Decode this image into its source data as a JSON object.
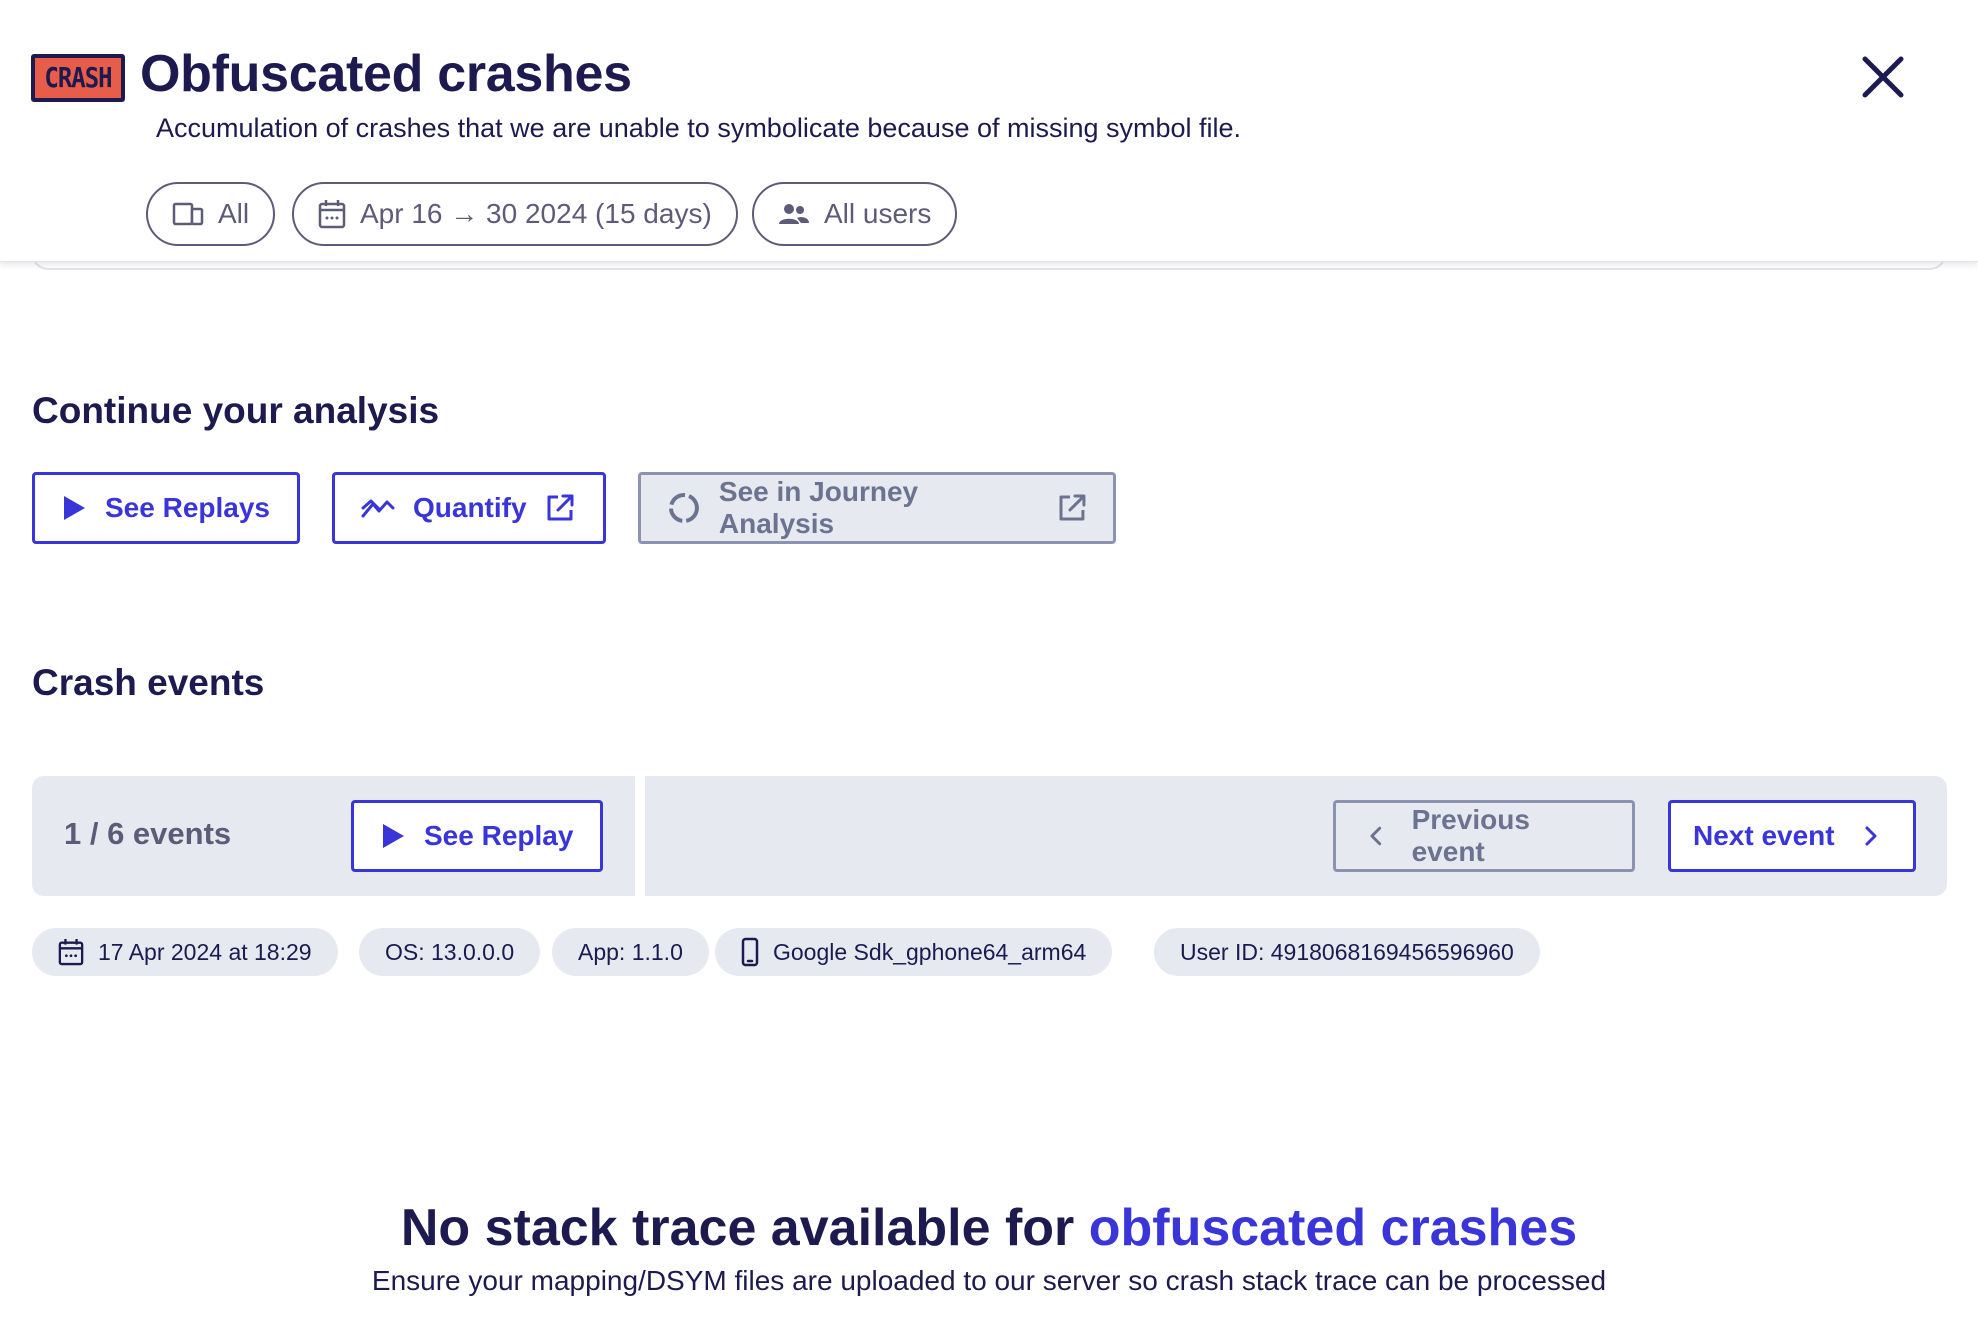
{
  "header": {
    "badge": "CRASH",
    "title": "Obfuscated crashes",
    "subtitle": "Accumulation of crashes that we are unable to symbolicate because of missing symbol file.",
    "filters": {
      "device": "All",
      "date_range": "Apr 16 → 30 2024 (15 days)",
      "users": "All users"
    }
  },
  "analysis": {
    "title": "Continue your analysis",
    "see_replays": "See Replays",
    "quantify": "Quantify",
    "journey": "See in Journey Analysis"
  },
  "crash_events": {
    "title": "Crash events",
    "count": "1 / 6 events",
    "see_replay": "See Replay",
    "previous": "Previous event",
    "next": "Next event",
    "tags": {
      "date": "17 Apr 2024 at 18:29",
      "os": "OS: 13.0.0.0",
      "app": "App: 1.1.0",
      "device": "Google Sdk_gphone64_arm64",
      "user_id": "User ID: 4918068169456596960"
    }
  },
  "empty_state": {
    "title_prefix": "No stack trace available for ",
    "title_accent": "obfuscated crashes",
    "subtitle": "Ensure your mapping/DSYM files are uploaded to our server so crash stack trace can be processed"
  },
  "colors": {
    "primary": "#3a35d8",
    "navy": "#1c1a4f",
    "badge": "#e85c4a",
    "panel": "#e6e9f0"
  }
}
